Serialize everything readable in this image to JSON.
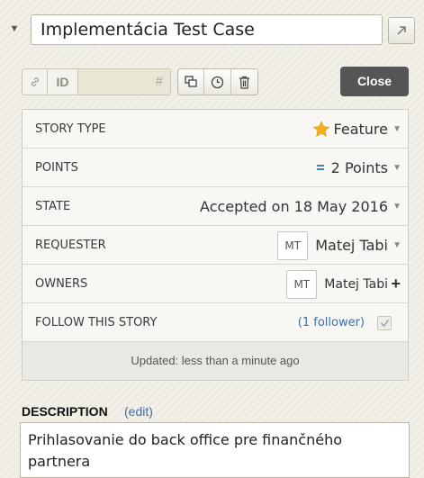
{
  "story": {
    "title": "Implementácia Test Case",
    "collapse_icon": "triangle-down-icon",
    "expand_icon": "arrow-up-right-icon"
  },
  "toolbar": {
    "id_label": "ID",
    "id_placeholder": "#",
    "link_icon": "link-icon",
    "actions": [
      "clone-icon",
      "history-icon",
      "trash-icon"
    ],
    "close_label": "Close"
  },
  "info": {
    "story_type": {
      "label": "STORY TYPE",
      "value": "Feature",
      "icon": "star-icon"
    },
    "points": {
      "label": "POINTS",
      "value": "2 Points",
      "icon": "estimate-icon"
    },
    "state": {
      "label": "STATE",
      "value": "Accepted on 18 May 2016"
    },
    "requester": {
      "label": "REQUESTER",
      "initials": "MT",
      "name": "Matej Tabi"
    },
    "owners": {
      "label": "OWNERS",
      "initials": "MT",
      "name": "Matej Tabi"
    },
    "follow": {
      "label": "FOLLOW THIS STORY",
      "followers": "(1 follower)",
      "checked": true
    },
    "updated": "Updated: less than a minute ago"
  },
  "description": {
    "label": "DESCRIPTION",
    "edit_label": "(edit)",
    "text": "Prihlasovanie do back office pre finančného partnera"
  },
  "colors": {
    "background": "#eeece2",
    "close_button": "#555555",
    "star": "#f2b01e",
    "link": "#3d6ea8"
  }
}
